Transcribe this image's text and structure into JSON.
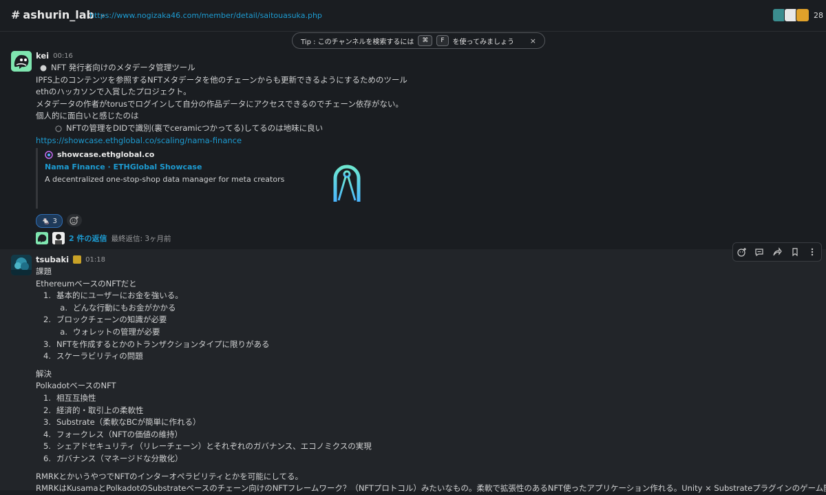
{
  "header": {
    "channel_hash": "#",
    "channel_name": "ashurin_lab",
    "topic_link": "https://www.nogizaka46.com/member/detail/saitouasuka.php",
    "member_count": "28"
  },
  "tip": {
    "prefix": "Tip : このチャンネルを検索するには",
    "key1": "⌘",
    "key2": "F",
    "suffix": "を使ってみましょう",
    "close": "×"
  },
  "message1": {
    "user": "kei",
    "time": "00:16",
    "lines": {
      "l1": "NFT 発行者向けのメタデータ管理ツール",
      "l2": "IPFS上のコンテンツを参照するNFTメタデータを他のチェーンからも更新できるようにするためのツール",
      "l3": "ethのハッカソンで入賞したプロジェクト。",
      "l4": "メタデータの作者がtorusでログインして自分の作品データにアクセスできるのでチェーン依存がない。",
      "l5": "個人的に面白いと感じたのは",
      "l6": "NFTの管理をDIDで識別(裏でceramicつかってる)してるのは地味に良い"
    },
    "link": "https://showcase.ethglobal.co/scaling/nama-finance",
    "unfurl": {
      "site": "showcase.ethglobal.co",
      "title": "Nama Finance · ETHGlobal Showcase",
      "description": "A decentralized one-stop-shop data manager for meta creators"
    },
    "reaction_count": "3",
    "replies": {
      "count_label": "2 件の返信",
      "last_reply": "最終返信: 3ヶ月前"
    }
  },
  "message2": {
    "user": "tsubaki",
    "time": "01:18",
    "heading1": "課題",
    "intro1": "EthereumベースのNFTだと",
    "problems": [
      {
        "num": "1.",
        "text": "基本的にユーザーにお金を強いる。"
      },
      {
        "num": "a.",
        "text": "どんな行動にもお金がかかる"
      },
      {
        "num": "2.",
        "text": "ブロックチェーンの知識が必要"
      },
      {
        "num": "a.",
        "text": "ウォレットの管理が必要"
      },
      {
        "num": "3.",
        "text": "NFTを作成するとかのトランザクションタイプに限りがある"
      },
      {
        "num": "4.",
        "text": "スケーラビリティの問題"
      }
    ],
    "heading2": "解決",
    "intro2": "PolkadotベースのNFT",
    "solutions": [
      {
        "num": "1.",
        "text": "相互互換性"
      },
      {
        "num": "2.",
        "text": "経済的・取引上の柔軟性"
      },
      {
        "num": "3.",
        "text": "Substrate（柔軟なBCが簡単に作れる）"
      },
      {
        "num": "4.",
        "text": "フォークレス（NFTの価値の維持）"
      },
      {
        "num": "5.",
        "text": "シェアドセキュリティ（リレーチェーン）とそれぞれのガバナンス、エコノミクスの実現"
      },
      {
        "num": "6.",
        "text": "ガバナンス（マネージドな分散化）"
      }
    ],
    "outro1": "RMRKとかいうやつでNFTのインターオペラビリティとかを可能にしてる。",
    "outro2": "RMRKはKusamaとPolkadotのSubstrateベースのチェーン向けのNFTフレームワーク？（NFTプロトコル）みたいなもの。柔軟で拡張性のあるNFT使ったアプリケーション作れる。Unity × Substrateプラグインのゲーム開発と"
  },
  "colors": {
    "background": "#1a1d21",
    "hover_background": "#222529",
    "link": "#1d9bd1",
    "text": "#d1d2d3"
  }
}
